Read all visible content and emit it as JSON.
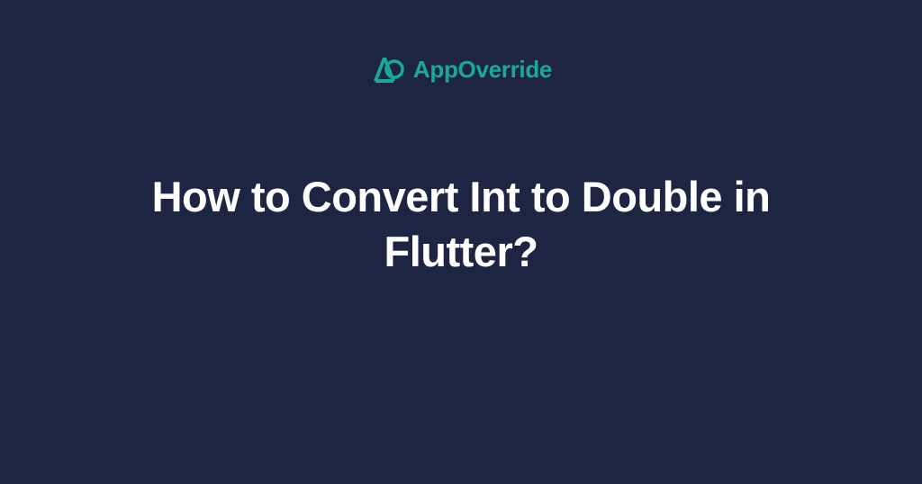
{
  "brand": {
    "name": "AppOverride",
    "icon_name": "appoverride-logo",
    "accent_color": "#18a999"
  },
  "title": "How to Convert Int to Double in Flutter?"
}
